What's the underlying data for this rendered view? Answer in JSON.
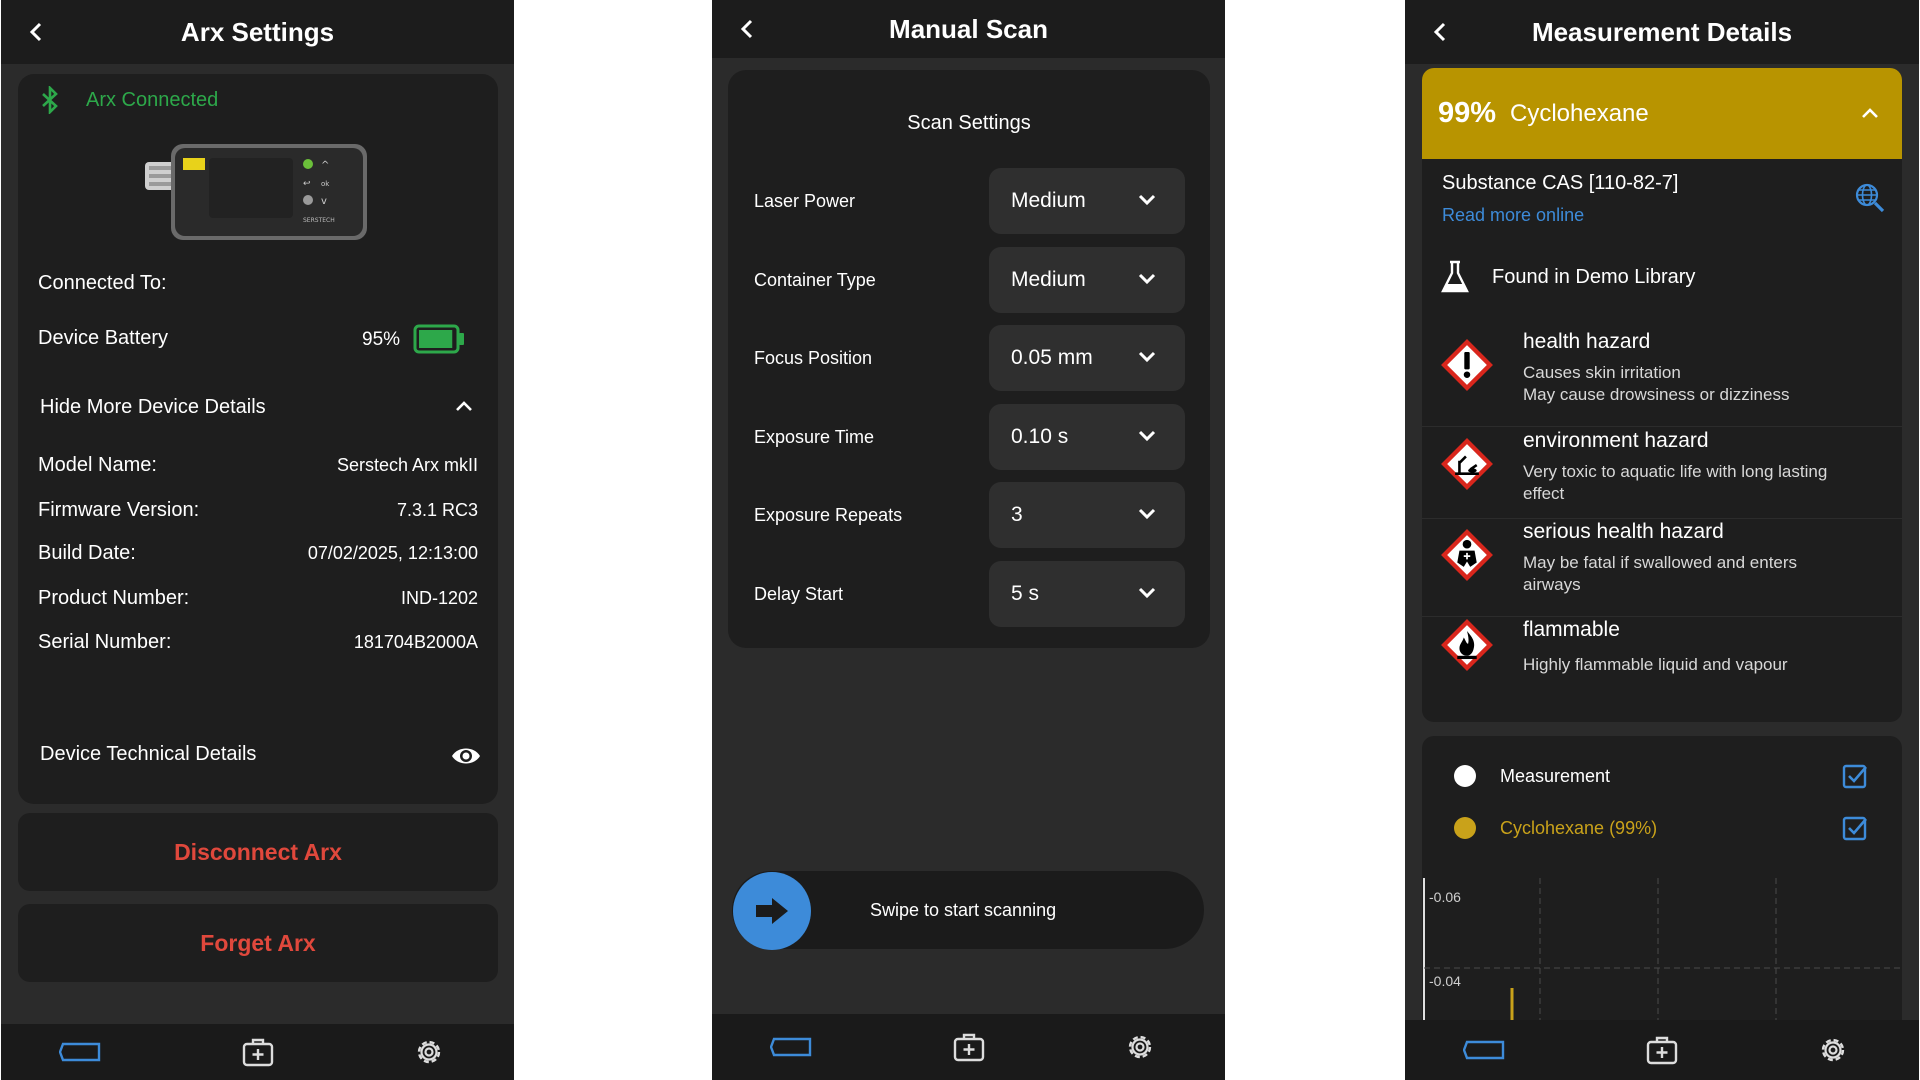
{
  "colors": {
    "accent_blue": "#3d8bd9",
    "green": "#2da84a",
    "red": "#e0483c",
    "gold": "#b89400"
  },
  "arx_settings": {
    "title": "Arx Settings",
    "connection_status": "Arx Connected",
    "connected_to_label": "Connected To:",
    "battery_label": "Device Battery",
    "battery_value": "95%",
    "battery_level": 0.95,
    "toggle_label": "Hide More Device Details",
    "details": [
      {
        "label": "Model Name:",
        "value": "Serstech Arx mkII"
      },
      {
        "label": "Firmware Version:",
        "value": "7.3.1 RC3"
      },
      {
        "label": "Build Date:",
        "value": "07/02/2025, 12:13:00"
      },
      {
        "label": "Product Number:",
        "value": "IND-1202"
      },
      {
        "label": "Serial Number:",
        "value": "181704B2000A"
      }
    ],
    "tech_details_label": "Device Technical Details",
    "disconnect_label": "Disconnect Arx",
    "forget_label": "Forget Arx",
    "device_brand": "SERSTECH"
  },
  "manual_scan": {
    "title": "Manual Scan",
    "section_title": "Scan Settings",
    "settings": [
      {
        "label": "Laser Power",
        "value": "Medium"
      },
      {
        "label": "Container Type",
        "value": "Medium"
      },
      {
        "label": "Focus Position",
        "value": "0.05 mm"
      },
      {
        "label": "Exposure Time",
        "value": "0.10 s"
      },
      {
        "label": "Exposure Repeats",
        "value": "3"
      },
      {
        "label": "Delay Start",
        "value": "5 s"
      }
    ],
    "swipe_label": "Swipe to start scanning"
  },
  "measurement_details": {
    "title": "Measurement Details",
    "match_percent": "99%",
    "substance_name": "Cyclohexane",
    "cas_label": "Substance CAS [110-82-7]",
    "read_more": "Read more online",
    "library_label": "Found in Demo Library",
    "hazards": [
      {
        "name": "health hazard",
        "desc": [
          "Causes skin irritation",
          "May cause drowsiness or dizziness"
        ]
      },
      {
        "name": "environment hazard",
        "desc": [
          "Very toxic to aquatic life with long lasting",
          "effect"
        ]
      },
      {
        "name": "serious health hazard",
        "desc": [
          "May be fatal if swallowed and enters",
          "airways"
        ]
      },
      {
        "name": "flammable",
        "desc": [
          "Highly flammable liquid and vapour"
        ]
      }
    ],
    "legend": [
      {
        "label": "Measurement",
        "color": "#ffffff"
      },
      {
        "label": "Cyclohexane (99%)",
        "color": "#c9a21a"
      }
    ],
    "chart_data": {
      "type": "line",
      "y_tick_labels": [
        "-0.06",
        "-0.04"
      ],
      "series": [
        {
          "name": "Measurement",
          "values": []
        },
        {
          "name": "Cyclohexane (99%)",
          "values": []
        }
      ]
    }
  }
}
